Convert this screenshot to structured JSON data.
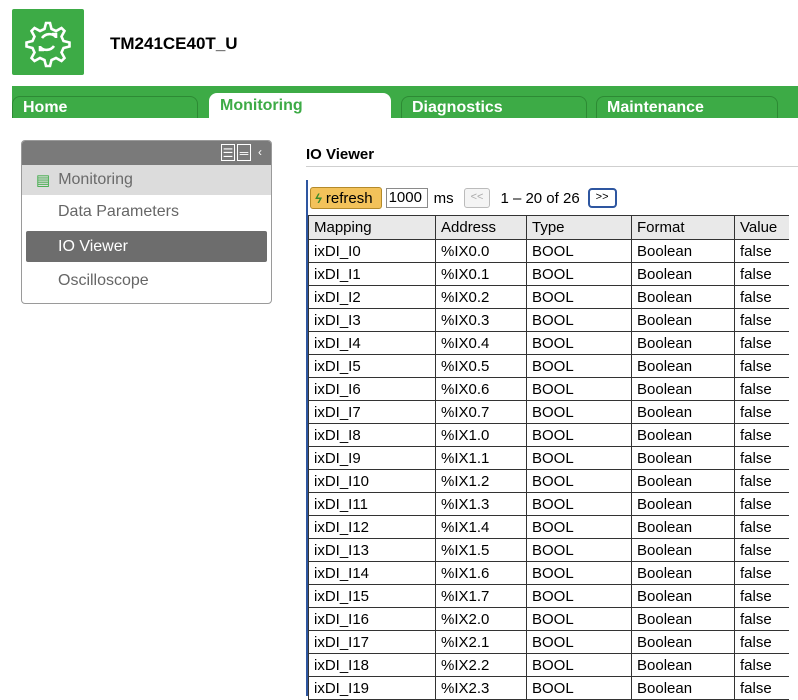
{
  "app": {
    "device_name": "TM241CE40T_U"
  },
  "tabs": [
    {
      "label": "Home",
      "active": false
    },
    {
      "label": "Monitoring",
      "active": true
    },
    {
      "label": "Diagnostics",
      "active": false
    },
    {
      "label": "Maintenance",
      "active": false
    }
  ],
  "sidebar": {
    "section_label": "Monitoring",
    "items": [
      {
        "label": "Data Parameters",
        "selected": false
      },
      {
        "label": "IO Viewer",
        "selected": true
      },
      {
        "label": "Oscilloscope",
        "selected": false
      }
    ]
  },
  "main": {
    "title": "IO Viewer",
    "toolbar": {
      "refresh_label": "refresh",
      "interval_value": "1000",
      "interval_unit": "ms",
      "prev_label": "<<",
      "pager_text": "1 – 20 of 26",
      "next_label": ">>"
    },
    "table": {
      "headers": [
        "Mapping",
        "Address",
        "Type",
        "Format",
        "Value"
      ],
      "rows": [
        [
          "ixDI_I0",
          "%IX0.0",
          "BOOL",
          "Boolean",
          "false"
        ],
        [
          "ixDI_I1",
          "%IX0.1",
          "BOOL",
          "Boolean",
          "false"
        ],
        [
          "ixDI_I2",
          "%IX0.2",
          "BOOL",
          "Boolean",
          "false"
        ],
        [
          "ixDI_I3",
          "%IX0.3",
          "BOOL",
          "Boolean",
          "false"
        ],
        [
          "ixDI_I4",
          "%IX0.4",
          "BOOL",
          "Boolean",
          "false"
        ],
        [
          "ixDI_I5",
          "%IX0.5",
          "BOOL",
          "Boolean",
          "false"
        ],
        [
          "ixDI_I6",
          "%IX0.6",
          "BOOL",
          "Boolean",
          "false"
        ],
        [
          "ixDI_I7",
          "%IX0.7",
          "BOOL",
          "Boolean",
          "false"
        ],
        [
          "ixDI_I8",
          "%IX1.0",
          "BOOL",
          "Boolean",
          "false"
        ],
        [
          "ixDI_I9",
          "%IX1.1",
          "BOOL",
          "Boolean",
          "false"
        ],
        [
          "ixDI_I10",
          "%IX1.2",
          "BOOL",
          "Boolean",
          "false"
        ],
        [
          "ixDI_I11",
          "%IX1.3",
          "BOOL",
          "Boolean",
          "false"
        ],
        [
          "ixDI_I12",
          "%IX1.4",
          "BOOL",
          "Boolean",
          "false"
        ],
        [
          "ixDI_I13",
          "%IX1.5",
          "BOOL",
          "Boolean",
          "false"
        ],
        [
          "ixDI_I14",
          "%IX1.6",
          "BOOL",
          "Boolean",
          "false"
        ],
        [
          "ixDI_I15",
          "%IX1.7",
          "BOOL",
          "Boolean",
          "false"
        ],
        [
          "ixDI_I16",
          "%IX2.0",
          "BOOL",
          "Boolean",
          "false"
        ],
        [
          "ixDI_I17",
          "%IX2.1",
          "BOOL",
          "Boolean",
          "false"
        ],
        [
          "ixDI_I18",
          "%IX2.2",
          "BOOL",
          "Boolean",
          "false"
        ],
        [
          "ixDI_I19",
          "%IX2.3",
          "BOOL",
          "Boolean",
          "false"
        ]
      ]
    }
  },
  "colors": {
    "brand_green": "#3dab46",
    "refresh_button": "#f3c25a",
    "selected_item": "#6d6d6d"
  },
  "icons": [
    "gear-logo-icon",
    "list-view-icon",
    "compact-view-icon",
    "collapse-icon",
    "monitoring-icon",
    "refresh-icon"
  ]
}
